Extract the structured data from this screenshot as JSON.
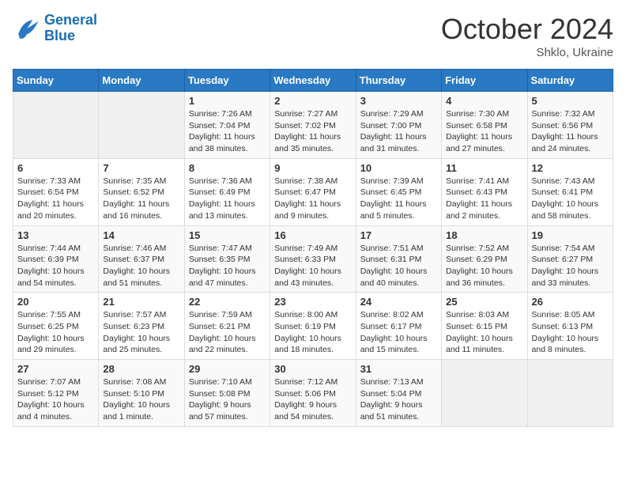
{
  "logo": {
    "line1": "General",
    "line2": "Blue"
  },
  "title": "October 2024",
  "subtitle": "Shklo, Ukraine",
  "days_header": [
    "Sunday",
    "Monday",
    "Tuesday",
    "Wednesday",
    "Thursday",
    "Friday",
    "Saturday"
  ],
  "weeks": [
    [
      {
        "day": "",
        "sunrise": "",
        "sunset": "",
        "daylight": ""
      },
      {
        "day": "",
        "sunrise": "",
        "sunset": "",
        "daylight": ""
      },
      {
        "day": "1",
        "sunrise": "Sunrise: 7:26 AM",
        "sunset": "Sunset: 7:04 PM",
        "daylight": "Daylight: 11 hours and 38 minutes."
      },
      {
        "day": "2",
        "sunrise": "Sunrise: 7:27 AM",
        "sunset": "Sunset: 7:02 PM",
        "daylight": "Daylight: 11 hours and 35 minutes."
      },
      {
        "day": "3",
        "sunrise": "Sunrise: 7:29 AM",
        "sunset": "Sunset: 7:00 PM",
        "daylight": "Daylight: 11 hours and 31 minutes."
      },
      {
        "day": "4",
        "sunrise": "Sunrise: 7:30 AM",
        "sunset": "Sunset: 6:58 PM",
        "daylight": "Daylight: 11 hours and 27 minutes."
      },
      {
        "day": "5",
        "sunrise": "Sunrise: 7:32 AM",
        "sunset": "Sunset: 6:56 PM",
        "daylight": "Daylight: 11 hours and 24 minutes."
      }
    ],
    [
      {
        "day": "6",
        "sunrise": "Sunrise: 7:33 AM",
        "sunset": "Sunset: 6:54 PM",
        "daylight": "Daylight: 11 hours and 20 minutes."
      },
      {
        "day": "7",
        "sunrise": "Sunrise: 7:35 AM",
        "sunset": "Sunset: 6:52 PM",
        "daylight": "Daylight: 11 hours and 16 minutes."
      },
      {
        "day": "8",
        "sunrise": "Sunrise: 7:36 AM",
        "sunset": "Sunset: 6:49 PM",
        "daylight": "Daylight: 11 hours and 13 minutes."
      },
      {
        "day": "9",
        "sunrise": "Sunrise: 7:38 AM",
        "sunset": "Sunset: 6:47 PM",
        "daylight": "Daylight: 11 hours and 9 minutes."
      },
      {
        "day": "10",
        "sunrise": "Sunrise: 7:39 AM",
        "sunset": "Sunset: 6:45 PM",
        "daylight": "Daylight: 11 hours and 5 minutes."
      },
      {
        "day": "11",
        "sunrise": "Sunrise: 7:41 AM",
        "sunset": "Sunset: 6:43 PM",
        "daylight": "Daylight: 11 hours and 2 minutes."
      },
      {
        "day": "12",
        "sunrise": "Sunrise: 7:43 AM",
        "sunset": "Sunset: 6:41 PM",
        "daylight": "Daylight: 10 hours and 58 minutes."
      }
    ],
    [
      {
        "day": "13",
        "sunrise": "Sunrise: 7:44 AM",
        "sunset": "Sunset: 6:39 PM",
        "daylight": "Daylight: 10 hours and 54 minutes."
      },
      {
        "day": "14",
        "sunrise": "Sunrise: 7:46 AM",
        "sunset": "Sunset: 6:37 PM",
        "daylight": "Daylight: 10 hours and 51 minutes."
      },
      {
        "day": "15",
        "sunrise": "Sunrise: 7:47 AM",
        "sunset": "Sunset: 6:35 PM",
        "daylight": "Daylight: 10 hours and 47 minutes."
      },
      {
        "day": "16",
        "sunrise": "Sunrise: 7:49 AM",
        "sunset": "Sunset: 6:33 PM",
        "daylight": "Daylight: 10 hours and 43 minutes."
      },
      {
        "day": "17",
        "sunrise": "Sunrise: 7:51 AM",
        "sunset": "Sunset: 6:31 PM",
        "daylight": "Daylight: 10 hours and 40 minutes."
      },
      {
        "day": "18",
        "sunrise": "Sunrise: 7:52 AM",
        "sunset": "Sunset: 6:29 PM",
        "daylight": "Daylight: 10 hours and 36 minutes."
      },
      {
        "day": "19",
        "sunrise": "Sunrise: 7:54 AM",
        "sunset": "Sunset: 6:27 PM",
        "daylight": "Daylight: 10 hours and 33 minutes."
      }
    ],
    [
      {
        "day": "20",
        "sunrise": "Sunrise: 7:55 AM",
        "sunset": "Sunset: 6:25 PM",
        "daylight": "Daylight: 10 hours and 29 minutes."
      },
      {
        "day": "21",
        "sunrise": "Sunrise: 7:57 AM",
        "sunset": "Sunset: 6:23 PM",
        "daylight": "Daylight: 10 hours and 25 minutes."
      },
      {
        "day": "22",
        "sunrise": "Sunrise: 7:59 AM",
        "sunset": "Sunset: 6:21 PM",
        "daylight": "Daylight: 10 hours and 22 minutes."
      },
      {
        "day": "23",
        "sunrise": "Sunrise: 8:00 AM",
        "sunset": "Sunset: 6:19 PM",
        "daylight": "Daylight: 10 hours and 18 minutes."
      },
      {
        "day": "24",
        "sunrise": "Sunrise: 8:02 AM",
        "sunset": "Sunset: 6:17 PM",
        "daylight": "Daylight: 10 hours and 15 minutes."
      },
      {
        "day": "25",
        "sunrise": "Sunrise: 8:03 AM",
        "sunset": "Sunset: 6:15 PM",
        "daylight": "Daylight: 10 hours and 11 minutes."
      },
      {
        "day": "26",
        "sunrise": "Sunrise: 8:05 AM",
        "sunset": "Sunset: 6:13 PM",
        "daylight": "Daylight: 10 hours and 8 minutes."
      }
    ],
    [
      {
        "day": "27",
        "sunrise": "Sunrise: 7:07 AM",
        "sunset": "Sunset: 5:12 PM",
        "daylight": "Daylight: 10 hours and 4 minutes."
      },
      {
        "day": "28",
        "sunrise": "Sunrise: 7:08 AM",
        "sunset": "Sunset: 5:10 PM",
        "daylight": "Daylight: 10 hours and 1 minute."
      },
      {
        "day": "29",
        "sunrise": "Sunrise: 7:10 AM",
        "sunset": "Sunset: 5:08 PM",
        "daylight": "Daylight: 9 hours and 57 minutes."
      },
      {
        "day": "30",
        "sunrise": "Sunrise: 7:12 AM",
        "sunset": "Sunset: 5:06 PM",
        "daylight": "Daylight: 9 hours and 54 minutes."
      },
      {
        "day": "31",
        "sunrise": "Sunrise: 7:13 AM",
        "sunset": "Sunset: 5:04 PM",
        "daylight": "Daylight: 9 hours and 51 minutes."
      },
      {
        "day": "",
        "sunrise": "",
        "sunset": "",
        "daylight": ""
      },
      {
        "day": "",
        "sunrise": "",
        "sunset": "",
        "daylight": ""
      }
    ]
  ]
}
